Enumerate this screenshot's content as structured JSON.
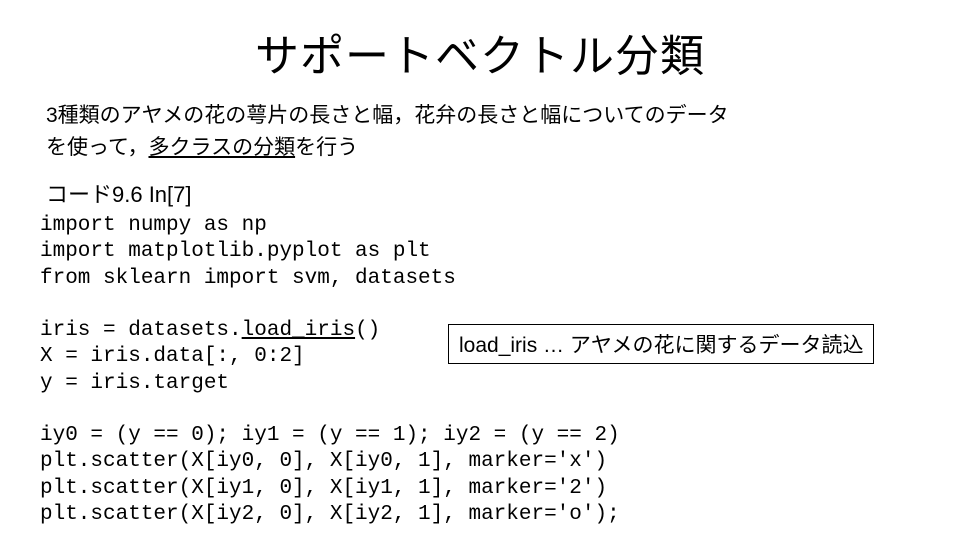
{
  "title": "サポートベクトル分類",
  "description": {
    "line1": "3種類のアヤメの花の萼片の長さと幅，花弁の長さと幅についてのデータ",
    "line2_pre": "を使って，",
    "line2_underlined": "多クラスの分類",
    "line2_post": "を行う"
  },
  "code_label": "コード9.6 In[7]",
  "code": {
    "l1": "import numpy as np",
    "l2": "import matplotlib.pyplot as plt",
    "l3": "from sklearn import svm, datasets",
    "l4": "",
    "l5_pre": "iris = datasets.",
    "l5_func": "load_iris",
    "l5_post": "()",
    "l6": "X = iris.data[:, 0:2]",
    "l7": "y = iris.target",
    "l8": "",
    "l9": "iy0 = (y == 0); iy1 = (y == 1); iy2 = (y == 2)",
    "l10": "plt.scatter(X[iy0, 0], X[iy0, 1], marker='x')",
    "l11": "plt.scatter(X[iy1, 0], X[iy1, 1], marker='2')",
    "l12": "plt.scatter(X[iy2, 0], X[iy2, 1], marker='o');"
  },
  "callout": "load_iris … アヤメの花に関するデータ読込"
}
